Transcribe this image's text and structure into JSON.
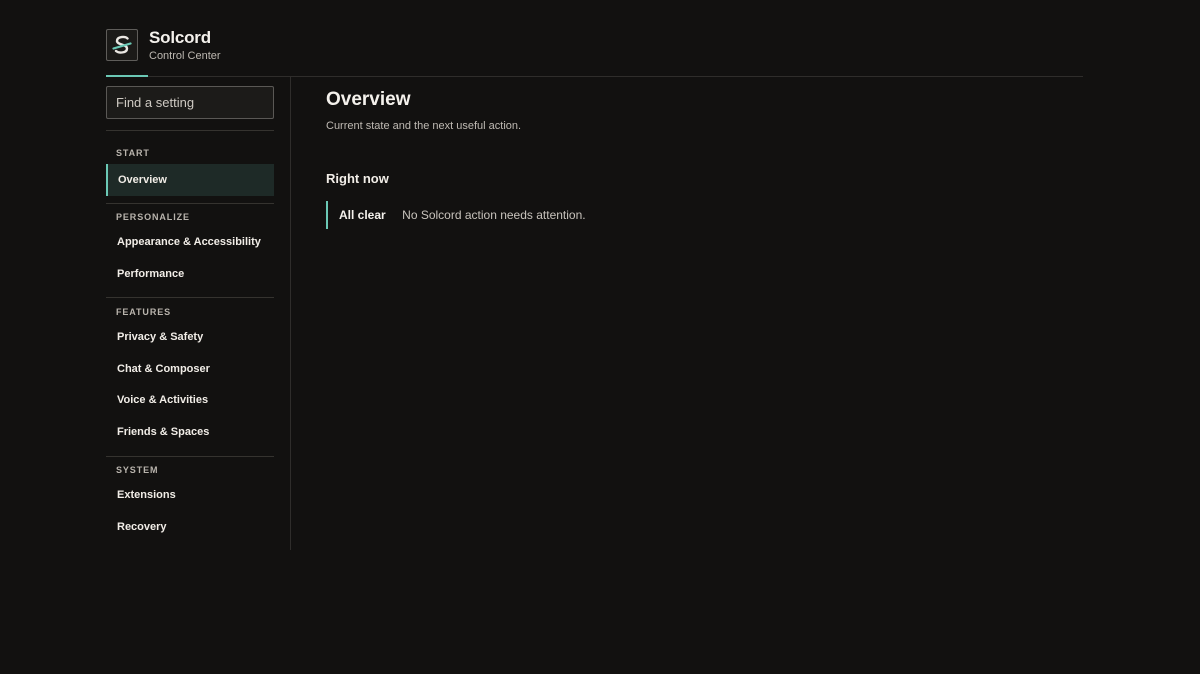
{
  "brand": {
    "name": "Solcord",
    "subtitle": "Control Center",
    "logo_icon": "s-letter-logo-icon",
    "accent_color": "#6bc8b5"
  },
  "search": {
    "placeholder": "Find a setting",
    "value": ""
  },
  "sidebar": {
    "sections": [
      {
        "label": "START",
        "items": [
          {
            "label": "Overview",
            "active": true
          }
        ]
      },
      {
        "label": "PERSONALIZE",
        "items": [
          {
            "label": "Appearance & Accessibility",
            "active": false
          },
          {
            "label": "Performance",
            "active": false
          }
        ]
      },
      {
        "label": "FEATURES",
        "items": [
          {
            "label": "Privacy & Safety",
            "active": false
          },
          {
            "label": "Chat & Composer",
            "active": false
          },
          {
            "label": "Voice & Activities",
            "active": false
          },
          {
            "label": "Friends & Spaces",
            "active": false
          }
        ]
      },
      {
        "label": "SYSTEM",
        "items": [
          {
            "label": "Extensions",
            "active": false
          },
          {
            "label": "Recovery",
            "active": false
          }
        ]
      }
    ]
  },
  "main": {
    "title": "Overview",
    "subtitle": "Current state and the next useful action.",
    "section_title": "Right now",
    "status": {
      "badge": "All clear",
      "message": "No Solcord action needs attention."
    }
  }
}
